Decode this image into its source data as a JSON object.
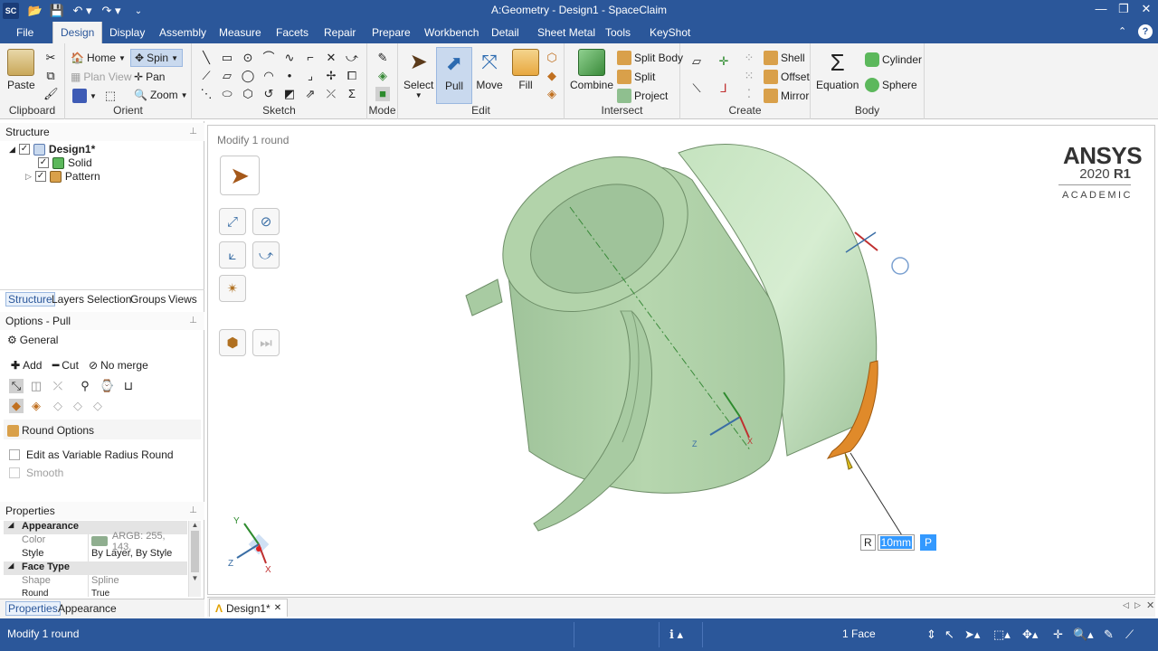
{
  "window": {
    "title": "A:Geometry - Design1 - SpaceClaim",
    "app_badge": "SC"
  },
  "menu": {
    "items": [
      "File",
      "Design",
      "Display",
      "Assembly",
      "Measure",
      "Facets",
      "Repair",
      "Prepare",
      "Workbench",
      "Detail",
      "Sheet Metal",
      "Tools",
      "KeyShot"
    ],
    "active": "Design"
  },
  "ribbon": {
    "clipboard": {
      "label": "Clipboard",
      "paste": "Paste"
    },
    "orient": {
      "label": "Orient",
      "home": "Home",
      "spin": "Spin",
      "plan_view": "Plan View",
      "pan": "Pan",
      "zoom": "Zoom"
    },
    "sketch": {
      "label": "Sketch"
    },
    "mode": {
      "label": "Mode"
    },
    "edit": {
      "label": "Edit",
      "select": "Select",
      "pull": "Pull",
      "move": "Move",
      "fill": "Fill"
    },
    "intersect": {
      "label": "Intersect",
      "combine": "Combine",
      "split_body": "Split Body",
      "split": "Split",
      "project": "Project"
    },
    "create": {
      "label": "Create",
      "shell": "Shell",
      "offset": "Offset",
      "mirror": "Mirror"
    },
    "body": {
      "label": "Body",
      "equation": "Equation",
      "cylinder": "Cylinder",
      "sphere": "Sphere"
    }
  },
  "structure": {
    "header": "Structure",
    "tree": [
      {
        "label": "Design1*",
        "bold": true
      },
      {
        "label": "Solid"
      },
      {
        "label": "Pattern"
      }
    ],
    "tabs": [
      "Structure",
      "Layers",
      "Selection",
      "Groups",
      "Views"
    ]
  },
  "options": {
    "header": "Options - Pull",
    "general": "General",
    "add": "Add",
    "cut": "Cut",
    "no_merge": "No merge",
    "round_options": "Round Options",
    "variable_radius": "Edit as Variable Radius Round",
    "smooth": "Smooth"
  },
  "properties": {
    "header": "Properties",
    "appearance_cat": "Appearance",
    "color_key": "Color",
    "color_val": "ARGB: 255, 143,",
    "style_key": "Style",
    "style_val": "By Layer, By Style",
    "face_type_cat": "Face Type",
    "shape_key": "Shape",
    "shape_val": "Spline",
    "round_key": "Round",
    "round_val": "True",
    "tabs": [
      "Properties",
      "Appearance"
    ],
    "swatch_color": "#8fae8f"
  },
  "viewport": {
    "status": "Modify 1 round",
    "brand": "ANSYS",
    "version": "2020",
    "release": "R1",
    "edition": "ACADEMIC",
    "radius_label": "R",
    "radius_value": "10mm",
    "radius_p": "P",
    "triad": {
      "x": "X",
      "y": "Y",
      "z": "Z"
    },
    "part_color": "#b8d8b0",
    "round_color": "#e08a2a"
  },
  "doctab": {
    "label": "Design1*"
  },
  "statusbar": {
    "message": "Modify 1 round",
    "selection": "1 Face"
  }
}
